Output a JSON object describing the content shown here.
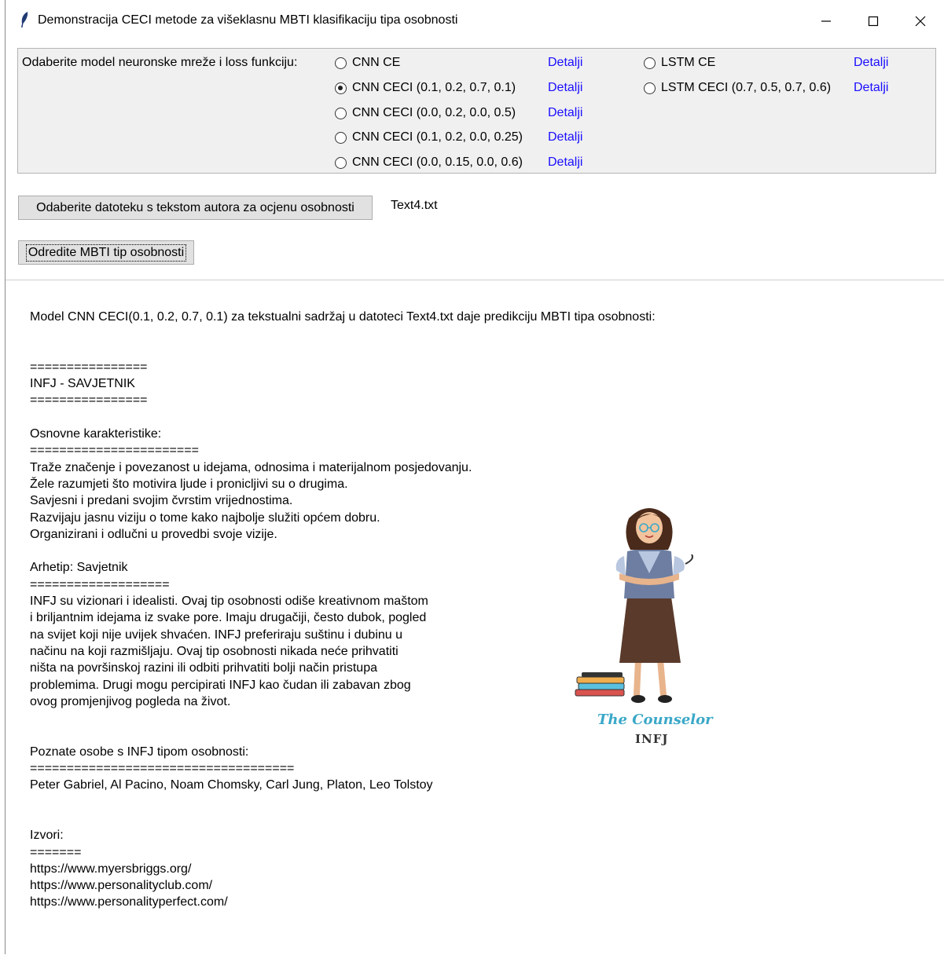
{
  "window": {
    "title": "Demonstracija CECI metode za višeklasnu MBTI klasifikaciju tipa osobnosti",
    "controls": [
      "minimize-icon",
      "maximize-icon",
      "close-icon"
    ]
  },
  "model_frame": {
    "label": "Odaberite model neuronske mreže i loss funkciju:",
    "link_text": "Detalji",
    "cnn_options": [
      {
        "label": "CNN CE",
        "selected": false
      },
      {
        "label": "CNN CECI (0.1, 0.2, 0.7, 0.1)",
        "selected": true
      },
      {
        "label": "CNN CECI (0.0, 0.2, 0.0, 0.5)",
        "selected": false
      },
      {
        "label": "CNN CECI (0.1, 0.2, 0.0, 0.25)",
        "selected": false
      },
      {
        "label": "CNN CECI (0.0, 0.15, 0.0, 0.6)",
        "selected": false
      }
    ],
    "lstm_options": [
      {
        "label": "LSTM CE",
        "selected": false
      },
      {
        "label": "LSTM CECI (0.7, 0.5, 0.7, 0.6)",
        "selected": false
      }
    ]
  },
  "file_button": {
    "label": "Odaberite datoteku s tekstom autora za ocjenu osobnosti"
  },
  "file_name": "Text4.txt",
  "run_button": {
    "label": "Odredite MBTI tip osobnosti"
  },
  "result": {
    "lines": [
      "Model CNN CECI(0.1, 0.2, 0.7, 0.1) za tekstualni sadržaj u datoteci Text4.txt daje predikciju MBTI tipa osobnosti:",
      "",
      "",
      "================",
      "INFJ - SAVJETNIK",
      "================",
      "",
      "Osnovne karakteristike:",
      "=======================",
      "Traže značenje i povezanost u idejama, odnosima i materijalnom posjedovanju.",
      "Žele razumjeti što motivira ljude i pronicljivi su o drugima.",
      "Savjesni i predani svojim čvrstim vrijednostima.",
      "Razvijaju jasnu viziju o tome kako najbolje služiti općem dobru.",
      "Organizirani i odlučni u provedbi svoje vizije.",
      "",
      "Arhetip: Savjetnik",
      "===================",
      "INFJ su vizionari i idealisti. Ovaj tip osobnosti odiše kreativnom maštom",
      "i briljantnim idejama iz svake pore. Imaju drugačiji, često dubok, pogled",
      "na svijet koji nije uvijek shvaćen. INFJ preferiraju suštinu i dubinu u",
      "načinu na koji razmišljaju. Ovaj tip osobnosti nikada neće prihvatiti",
      "ništa na površinskoj razini ili odbiti prihvatiti bolji način pristupa",
      "problemima. Drugi mogu percipirati INFJ kao čudan ili zabavan zbog",
      "ovog promjenjivog pogleda na život.",
      "",
      "",
      "Poznate osobe s INFJ tipom osobnosti:",
      "====================================",
      "Peter Gabriel, Al Pacino, Noam Chomsky, Carl Jung, Platon, Leo Tolstoy",
      "",
      "",
      "Izvori:",
      "=======",
      "https://www.myersbriggs.org/",
      "https://www.personalityclub.com/",
      "https://www.personalityperfect.com/"
    ]
  },
  "illustration": {
    "caption": "The Counselor",
    "type_label": "INFJ"
  },
  "colors": {
    "link": "#1a0dff",
    "frame_bg": "#f0f0f0",
    "button_bg": "#e1e1e1",
    "caption": "#3aa8c8"
  }
}
